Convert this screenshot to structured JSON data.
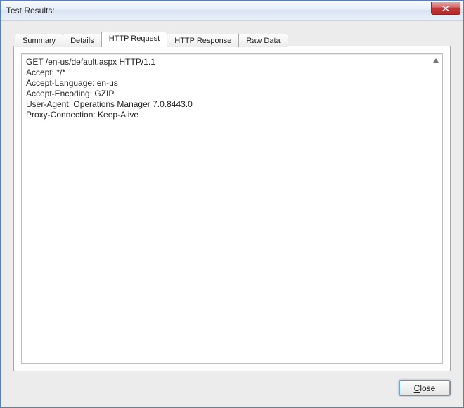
{
  "window": {
    "title": "Test Results:"
  },
  "tabs": {
    "t0": "Summary",
    "t1": "Details",
    "t2": "HTTP Request",
    "t3": "HTTP Response",
    "t4": "Raw Data",
    "activeIndex": 2
  },
  "content": {
    "httpRequest": "GET /en-us/default.aspx HTTP/1.1\nAccept: */*\nAccept-Language: en-us\nAccept-Encoding: GZIP\nUser-Agent: Operations Manager 7.0.8443.0\nProxy-Connection: Keep-Alive"
  },
  "footer": {
    "close_prefix": "C",
    "close_rest": "lose"
  }
}
